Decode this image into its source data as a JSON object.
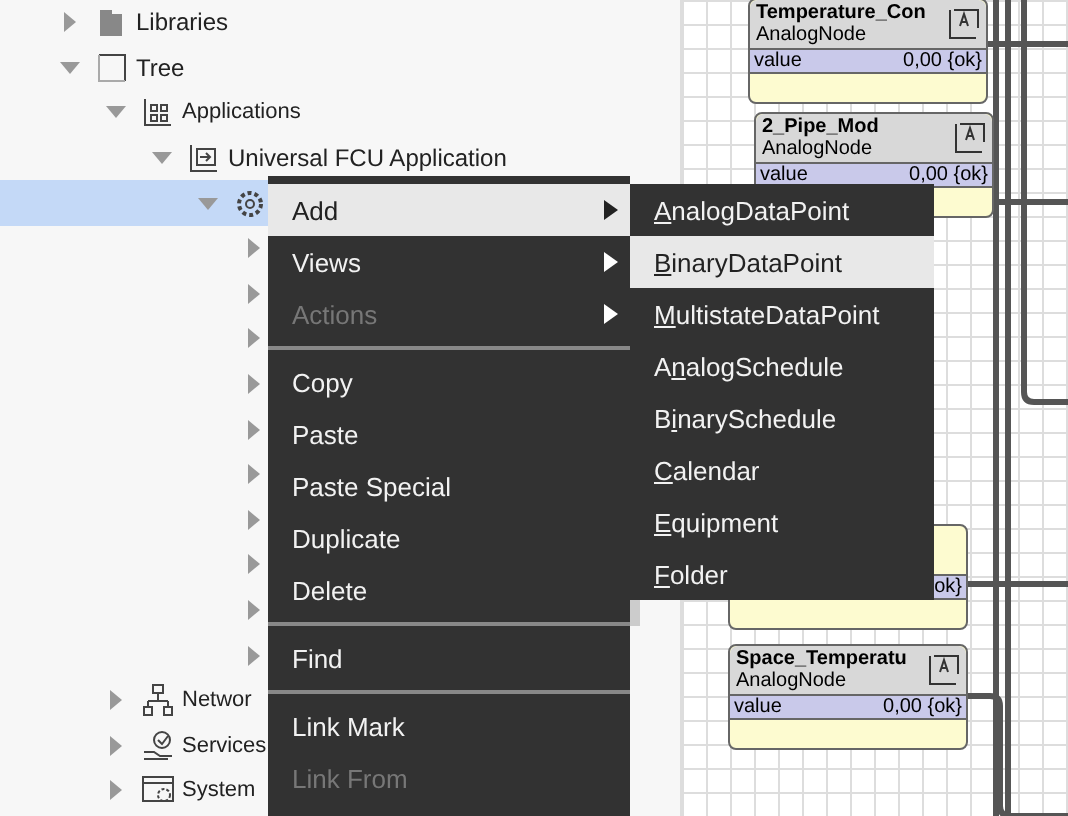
{
  "tree": [
    {
      "label": "Libraries",
      "expanded": false
    },
    {
      "label": "Tree",
      "expanded": true,
      "children": [
        {
          "label": "Applications",
          "expanded": true,
          "children": [
            {
              "label": "Universal FCU Application",
              "expanded": true,
              "children": [
                {
                  "selected": true,
                  "expanded": true,
                  "children": [
                    {
                      "expanded": false
                    },
                    {
                      "expanded": false
                    },
                    {
                      "expanded": false
                    },
                    {
                      "expanded": false
                    },
                    {
                      "expanded": false
                    },
                    {
                      "expanded": false
                    },
                    {
                      "expanded": false
                    },
                    {
                      "expanded": false
                    },
                    {
                      "expanded": false
                    },
                    {
                      "expanded": false
                    }
                  ]
                }
              ]
            }
          ]
        },
        {
          "label": "Networ",
          "expanded": false
        },
        {
          "label": "Services",
          "expanded": false
        },
        {
          "label": "System",
          "expanded": false
        }
      ]
    }
  ],
  "nodes": [
    {
      "title": "Temperature_Con",
      "type": "AnalogNode",
      "port": "value",
      "value": "0,00 {ok}"
    },
    {
      "title": "2_Pipe_Mod",
      "type": "AnalogNode",
      "port": "value",
      "value": "0,00 {ok}"
    },
    {
      "value": "ok}"
    },
    {
      "title": "Space_Temperatu",
      "type": "AnalogNode",
      "port": "value",
      "value": "0,00 {ok}"
    }
  ],
  "context_menu": [
    {
      "kind": "item",
      "label": "Add",
      "submenu": true,
      "selected": true,
      "disabled": false
    },
    {
      "kind": "item",
      "label": "Views",
      "submenu": true,
      "selected": false,
      "disabled": false
    },
    {
      "kind": "item",
      "label": "Actions",
      "submenu": true,
      "selected": false,
      "disabled": true
    },
    {
      "kind": "separator"
    },
    {
      "kind": "item",
      "label": "Copy",
      "submenu": false,
      "selected": false,
      "disabled": false
    },
    {
      "kind": "item",
      "label": "Paste",
      "submenu": false,
      "selected": false,
      "disabled": false
    },
    {
      "kind": "item",
      "label": "Paste Special",
      "submenu": false,
      "selected": false,
      "disabled": false
    },
    {
      "kind": "item",
      "label": "Duplicate",
      "submenu": false,
      "selected": false,
      "disabled": false
    },
    {
      "kind": "item",
      "label": "Delete",
      "submenu": false,
      "selected": false,
      "disabled": false
    },
    {
      "kind": "separator"
    },
    {
      "kind": "item",
      "label": "Find",
      "submenu": false,
      "selected": false,
      "disabled": false
    },
    {
      "kind": "separator"
    },
    {
      "kind": "item",
      "label": "Link Mark",
      "submenu": false,
      "selected": false,
      "disabled": false
    },
    {
      "kind": "item",
      "label": "Link From",
      "submenu": false,
      "selected": false,
      "disabled": true
    }
  ],
  "submenu": [
    {
      "mnemonic": "A",
      "after": "nalogDataPoint",
      "selected": false
    },
    {
      "mnemonic": "B",
      "after": "inaryDataPoint",
      "selected": true
    },
    {
      "mnemonic": "M",
      "after": "ultistateDataPoint",
      "selected": false
    },
    {
      "before": "A",
      "mnemonic": "n",
      "after": "alogSchedule",
      "selected": false
    },
    {
      "before": "B",
      "mnemonic": "i",
      "after": "narySchedule",
      "selected": false
    },
    {
      "mnemonic": "C",
      "after": "alendar",
      "selected": false
    },
    {
      "mnemonic": "E",
      "after": "quipment",
      "selected": false
    },
    {
      "mnemonic": "F",
      "after": "older",
      "selected": false
    }
  ]
}
